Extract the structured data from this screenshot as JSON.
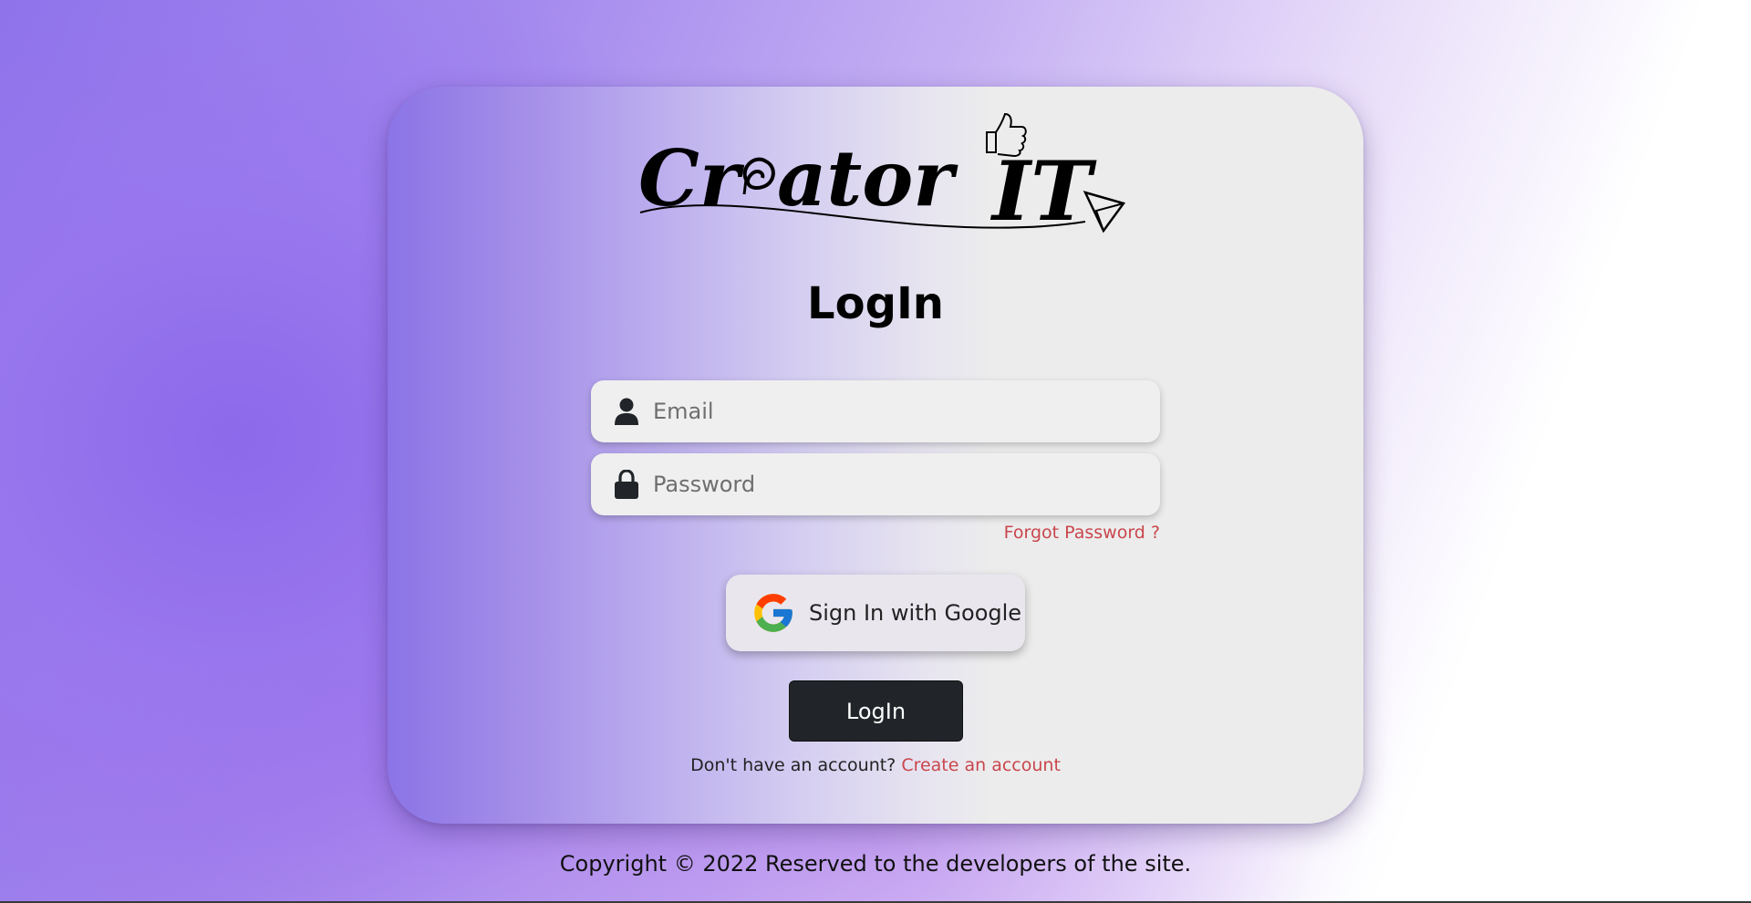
{
  "logo": {
    "text": "Creator IT",
    "part1": "Cr",
    "part2": "ator",
    "part3": "IT"
  },
  "title": "LogIn",
  "form": {
    "email_placeholder": "Email",
    "password_placeholder": "Password",
    "forgot_label": "Forgot Password ?",
    "google_label": "Sign In with Google",
    "login_label": "LogIn",
    "signup_prompt": "Don't have an account?",
    "signup_link": "Create an account"
  },
  "footer": {
    "copyright": "Copyright © 2022 Reserved to the developers of the site."
  },
  "colors": {
    "accent_link": "#c9464c",
    "button_dark": "#212529",
    "gradient_purple": "#8b74e6",
    "card_gray": "#ececec"
  },
  "icons": {
    "email": "user-icon",
    "password": "lock-icon",
    "google": "google-icon",
    "logo_thumb": "thumbs-up-icon",
    "logo_plane": "paper-plane-icon"
  }
}
